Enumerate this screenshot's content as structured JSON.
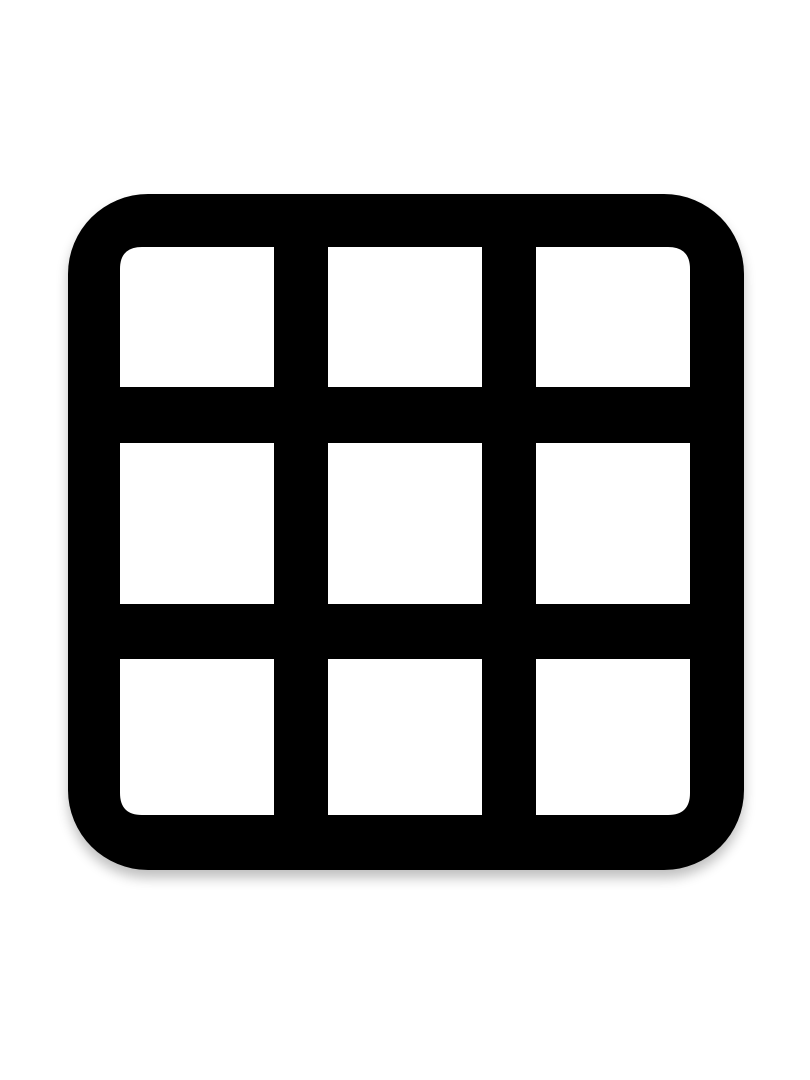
{
  "icon": {
    "name": "grid-3x3-icon",
    "rows": 3,
    "columns": 3,
    "stroke_color": "#000000",
    "background_color": "#ffffff"
  }
}
